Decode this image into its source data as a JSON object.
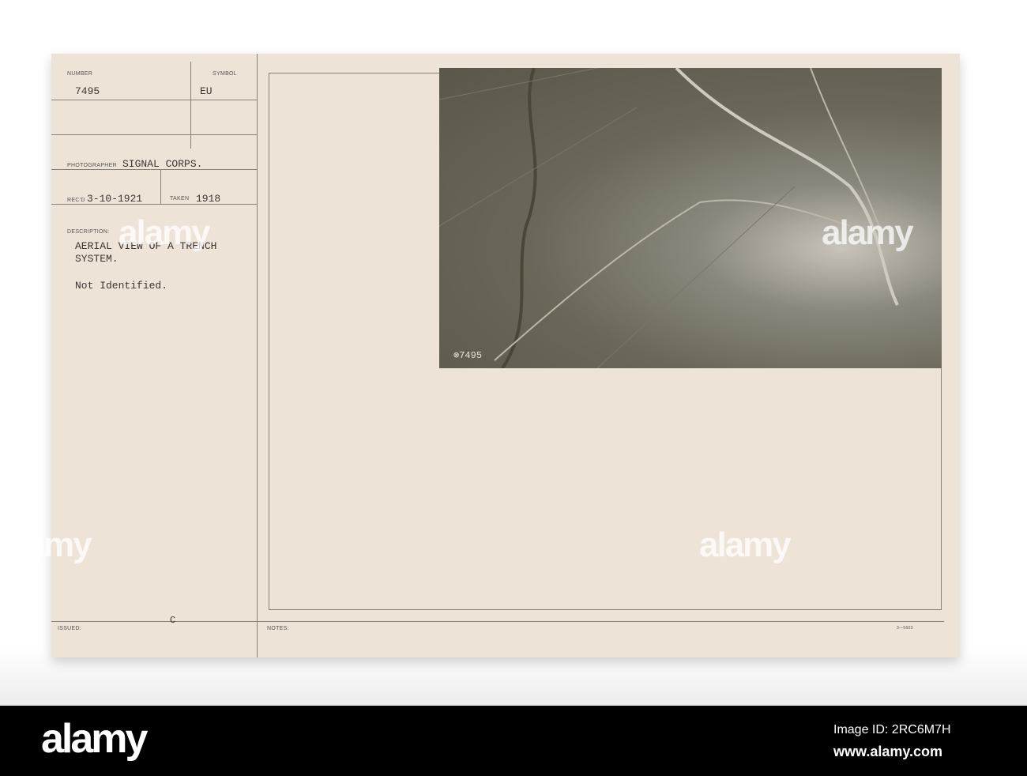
{
  "card": {
    "number_label": "NUMBER",
    "number": "7495",
    "symbol_label": "SYMBOL",
    "symbol": "EU",
    "photographer_label": "PHOTOGRAPHER",
    "photographer": "SIGNAL CORPS.",
    "recd_label": "REC'D",
    "recd": "3-10-1921",
    "taken_label": "TAKEN",
    "taken": "1918",
    "description_label": "DESCRIPTION:",
    "description_line1": "AERIAL VIEW OF A TRENCH",
    "description_line2": "SYSTEM.",
    "note": "Not Identified.",
    "issued_label": "ISSUED:",
    "issued": "C",
    "notes_label": "NOTES:",
    "form_number": "3—5603",
    "photo_number": "⊗7495"
  },
  "watermark": {
    "text": "alamy"
  },
  "footer": {
    "logo": "alamy",
    "image_id": "Image ID: 2RC6M7H",
    "url": "www.alamy.com"
  }
}
